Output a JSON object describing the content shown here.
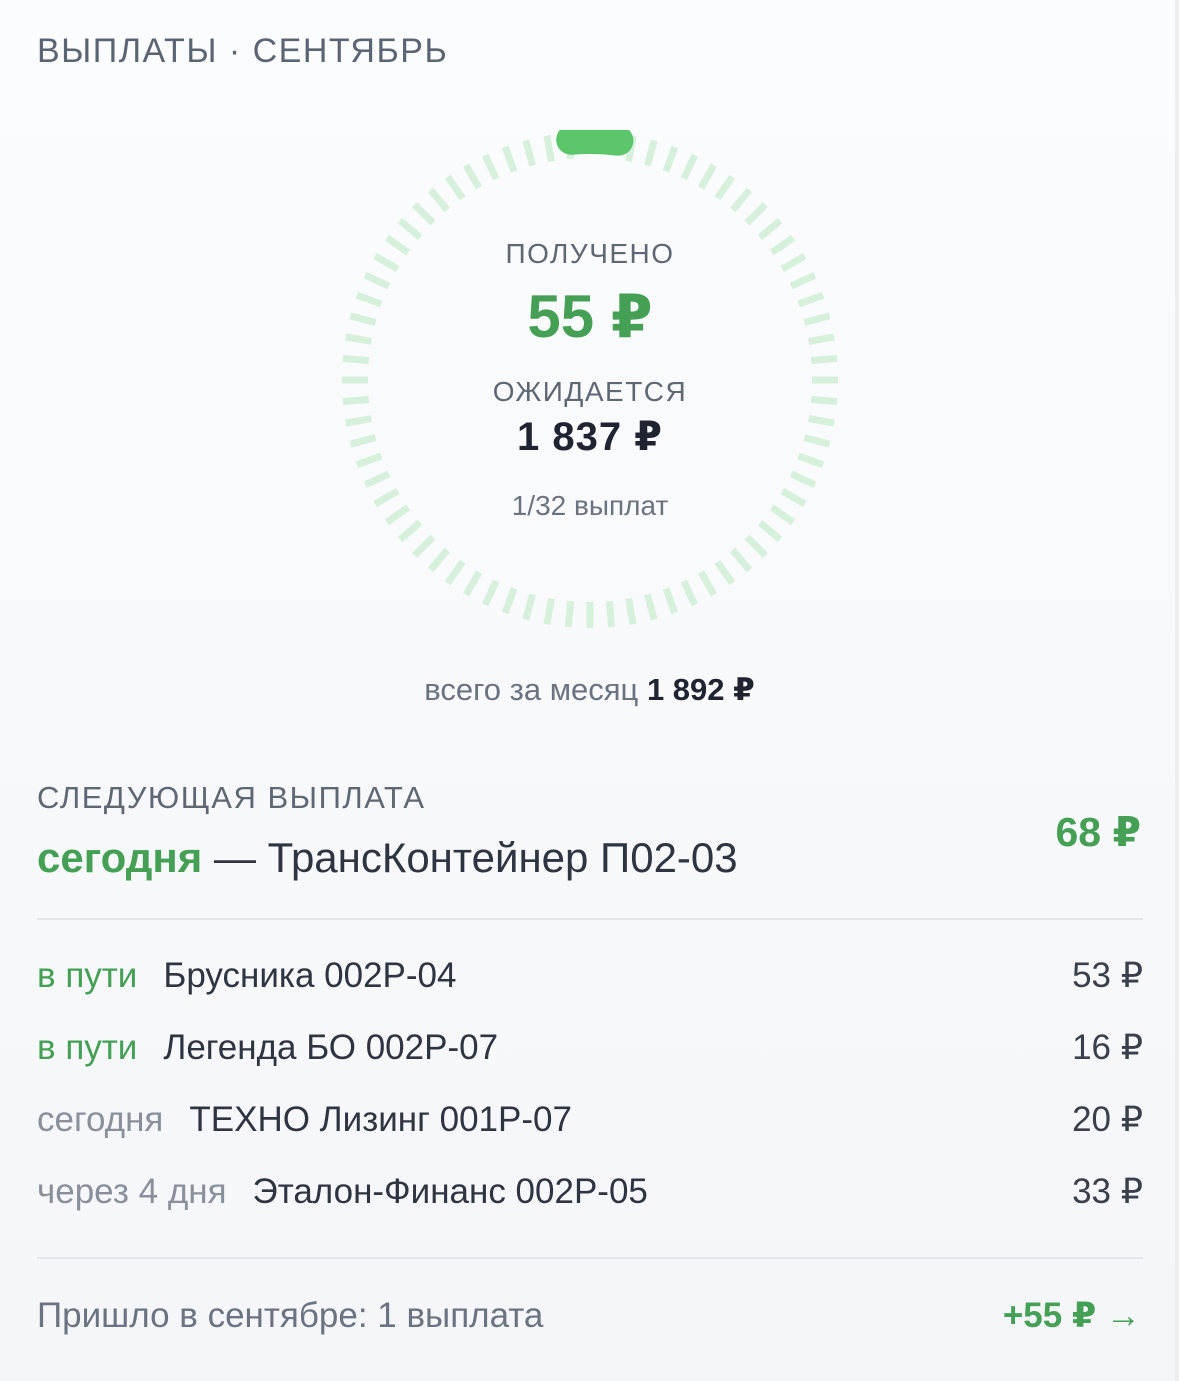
{
  "header": {
    "title": "ВЫПЛАТЫ · СЕНТЯБРЬ"
  },
  "ring": {
    "received_label": "ПОЛУЧЕНО",
    "received_value": "55 ₽",
    "expected_label": "ОЖИДАЕТСЯ",
    "expected_value": "1 837 ₽",
    "count_text": "1/32 выплат",
    "paid": 1,
    "total": 32,
    "color_done": "#5bc56a",
    "color_pending": "#d6f0dc"
  },
  "month_total": {
    "label": "всего за месяц",
    "value": "1 892 ₽"
  },
  "next_payout": {
    "label": "СЛЕДУЮЩАЯ ВЫПЛАТА",
    "when": "сегодня",
    "separator": " — ",
    "name": "ТрансКонтейнер П02-03",
    "amount": "68 ₽"
  },
  "payouts": [
    {
      "status": "в пути",
      "status_green": true,
      "name": "Брусника 002Р-04",
      "amount": "53 ₽"
    },
    {
      "status": "в пути",
      "status_green": true,
      "name": "Легенда БО 002Р-07",
      "amount": "16 ₽"
    },
    {
      "status": "сегодня",
      "status_green": false,
      "name": "ТЕХНО Лизинг 001Р-07",
      "amount": "20 ₽"
    },
    {
      "status": "через 4 дня",
      "status_green": false,
      "name": "Эталон-Финанс 002Р-05",
      "amount": "33 ₽"
    }
  ],
  "footer": {
    "text": "Пришло в сентябре: 1 выплата",
    "link": "+55 ₽ →"
  },
  "colors": {
    "accent_green": "#45a056",
    "text_dark": "#1f2430",
    "text_muted": "#6b7380"
  }
}
